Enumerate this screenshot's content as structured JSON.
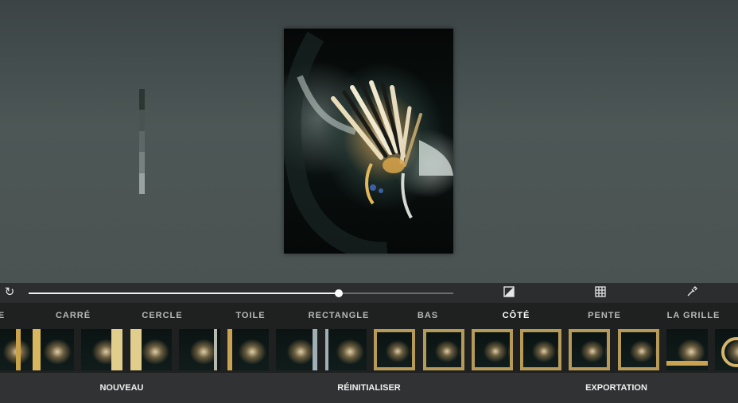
{
  "colors": {
    "accent": "#b59a58",
    "tab_inactive": "#b8b8b8",
    "tab_active": "#ffffff"
  },
  "toolbar": {
    "slider_value": 0.73,
    "icons": [
      "rotate-icon",
      "exposure-icon",
      "grid-icon",
      "eyedropper-icon"
    ]
  },
  "level_indicator": {
    "segment_colors": [
      "#2e3535",
      "#4a5352",
      "#5c6766",
      "#78817f",
      "#9aa3a1"
    ]
  },
  "tabs": [
    {
      "label": "E"
    },
    {
      "label": "CARRÉ"
    },
    {
      "label": "CERCLE"
    },
    {
      "label": "TOILE"
    },
    {
      "label": "RECTANGLE"
    },
    {
      "label": "BAS"
    },
    {
      "label": "CÔTÉ",
      "active": true
    },
    {
      "label": "PENTE"
    },
    {
      "label": "LA GRILLE"
    }
  ],
  "bottom": {
    "new_label": "NOUVEAU",
    "reset_label": "RÉINITIALISER",
    "export_label": "EXPORTATION"
  }
}
